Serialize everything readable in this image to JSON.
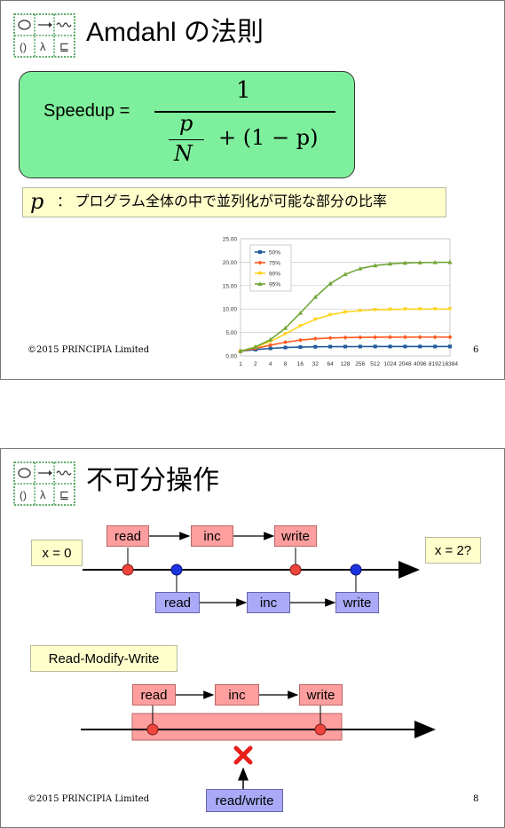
{
  "slide1": {
    "title": "Amdahl の法則",
    "formula": {
      "lhs": "Speedup =",
      "numerator": "1",
      "frac_p": "p",
      "frac_n": "N",
      "tail": "+ (1 − p)"
    },
    "note": {
      "symbol": "p",
      "text": "： プログラム全体の中で並列化が可能な部分の比率"
    },
    "footer": "©2015 PRINCIPIA Limited",
    "page_number": "6",
    "chart_data": {
      "type": "line",
      "categories": [
        "1",
        "2",
        "4",
        "8",
        "16",
        "32",
        "64",
        "128",
        "256",
        "512",
        "1024",
        "2048",
        "4096",
        "8192",
        "16384"
      ],
      "ylim": [
        0,
        25
      ],
      "yticks": [
        "0.00",
        "5.00",
        "10.00",
        "15.00",
        "20.00",
        "25.00"
      ],
      "grid": true,
      "legend_position": "top-left",
      "series": [
        {
          "name": "50%",
          "color": "#1f5b99",
          "marker": "square",
          "values": [
            1.0,
            1.33,
            1.6,
            1.78,
            1.88,
            1.94,
            1.97,
            1.98,
            1.99,
            2.0,
            2.0,
            2.0,
            2.0,
            2.0,
            2.0
          ]
        },
        {
          "name": "75%",
          "color": "#ff5a1e",
          "marker": "diamond",
          "values": [
            1.0,
            1.6,
            2.29,
            2.91,
            3.37,
            3.66,
            3.82,
            3.91,
            3.95,
            3.98,
            3.99,
            3.99,
            4.0,
            4.0,
            4.0
          ]
        },
        {
          "name": "90%",
          "color": "#ffd21e",
          "marker": "triangle-down",
          "values": [
            1.0,
            1.82,
            3.08,
            4.71,
            6.4,
            7.8,
            8.77,
            9.34,
            9.66,
            9.83,
            9.91,
            9.96,
            9.98,
            9.99,
            9.99
          ]
        },
        {
          "name": "95%",
          "color": "#71a636",
          "marker": "triangle-up",
          "values": [
            1.0,
            1.9,
            3.48,
            5.93,
            9.14,
            12.55,
            15.42,
            17.41,
            18.62,
            19.28,
            19.64,
            19.82,
            19.91,
            19.95,
            19.98
          ]
        }
      ]
    }
  },
  "slide2": {
    "title": "不可分操作",
    "x_initial": "x = 0",
    "x_result": "x = 2?",
    "row1": [
      "read",
      "inc",
      "write"
    ],
    "row2": [
      "read",
      "inc",
      "write"
    ],
    "rmw_label": "Read-Modify-Write",
    "row3": [
      "read",
      "inc",
      "write"
    ],
    "blocked_op": "read/write",
    "footer": "©2015 PRINCIPIA Limited",
    "page_number": "8"
  },
  "logo": {
    "glyphs": [
      "◯",
      "→",
      "〰",
      "()",
      "λ",
      "⊑"
    ]
  }
}
